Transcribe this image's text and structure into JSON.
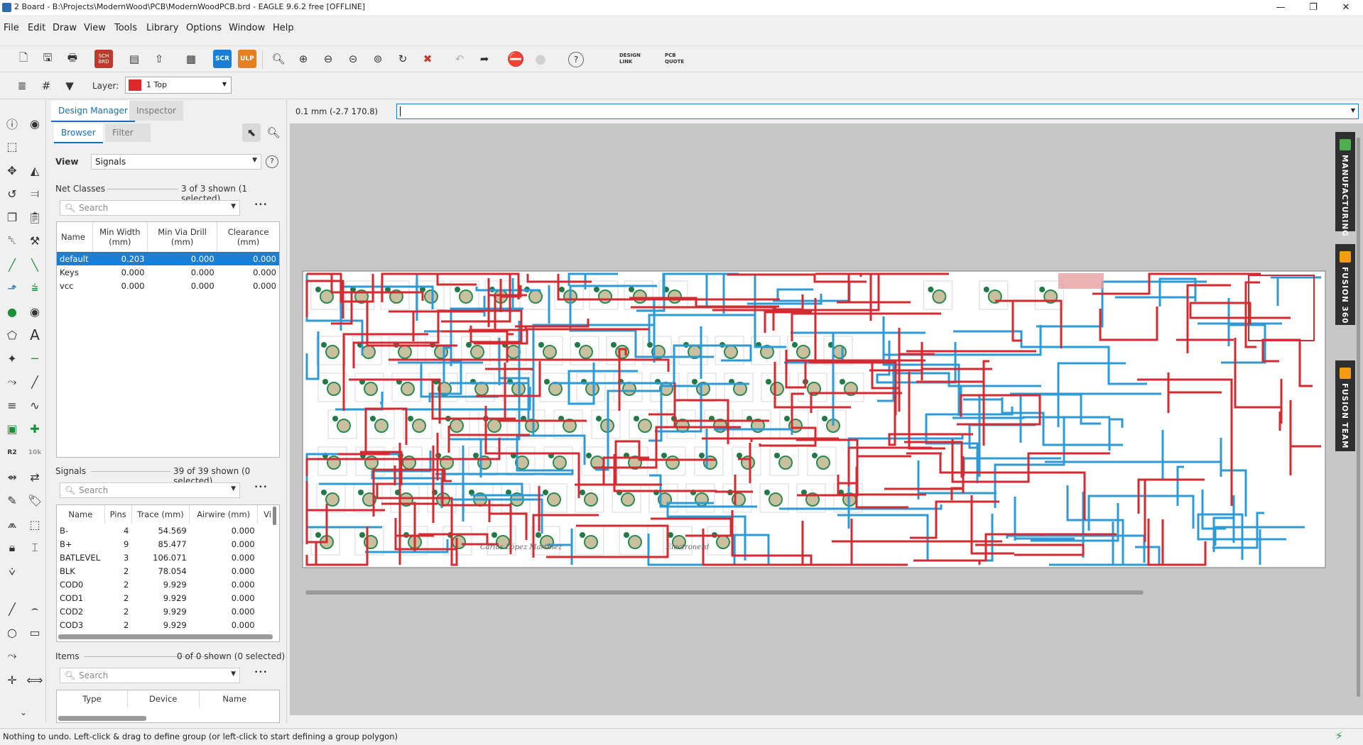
{
  "window": {
    "title": "2 Board - B:\\Projects\\ModernWood\\PCB\\ModernWoodPCB.brd - EAGLE 9.6.2 free [OFFLINE]",
    "min_glyph": "—",
    "max_glyph": "❐",
    "close_glyph": "✕"
  },
  "menu": [
    "File",
    "Edit",
    "Draw",
    "View",
    "Tools",
    "Library",
    "Options",
    "Window",
    "Help"
  ],
  "toolbar": {
    "sch_label": "SCH BRD",
    "scr_label": "SCR",
    "ulp_label": "ULP",
    "design_link_label": "DESIGN LINK",
    "pcb_quote_label": "PCB QUOTE",
    "help_glyph": "?"
  },
  "layerbar": {
    "layer_label": "Layer:",
    "layer_value": "1 Top",
    "layer_color": "#e0282a"
  },
  "panel": {
    "tabs": [
      "Design Manager",
      "Inspector"
    ],
    "subtabs": [
      "Browser",
      "Filter"
    ],
    "view_label": "View",
    "view_value": "Signals",
    "view_help": "?",
    "net_classes": {
      "label": "Net Classes",
      "count": "3 of 3 shown (1 selected)",
      "search_placeholder": "Search",
      "headers": [
        "Name",
        "Min Width\n(mm)",
        "Min Via Drill\n(mm)",
        "Clearance\n(mm)"
      ],
      "rows": [
        [
          "default",
          "0.203",
          "0.000",
          "0.000"
        ],
        [
          "Keys",
          "0.000",
          "0.000",
          "0.000"
        ],
        [
          "vcc",
          "0.000",
          "0.000",
          "0.000"
        ]
      ]
    },
    "signals": {
      "label": "Signals",
      "count": "39 of 39 shown (0 selected)",
      "search_placeholder": "Search",
      "headers": [
        "Name",
        "Pins",
        "Trace (mm)",
        "Airwire (mm)",
        "Vi"
      ],
      "rows": [
        [
          "B-",
          "4",
          "54.569",
          "0.000"
        ],
        [
          "B+",
          "9",
          "85.477",
          "0.000"
        ],
        [
          "BATLEVEL",
          "3",
          "106.071",
          "0.000"
        ],
        [
          "BLK",
          "2",
          "78.054",
          "0.000"
        ],
        [
          "COD0",
          "2",
          "9.929",
          "0.000"
        ],
        [
          "COD1",
          "2",
          "9.929",
          "0.000"
        ],
        [
          "COD2",
          "2",
          "9.929",
          "0.000"
        ],
        [
          "COD3",
          "2",
          "9.929",
          "0.000"
        ]
      ]
    },
    "items": {
      "label": "Items",
      "count": "0 of 0 shown (0 selected)",
      "search_placeholder": "Search",
      "headers": [
        "Type",
        "Device",
        "Name"
      ]
    },
    "more_glyph": "•••"
  },
  "canvas": {
    "coords": "0.1 mm (-2.7 170.8)",
    "pcb_label_1": "Carlos López Martínez",
    "pcb_label_2": "Electronerd"
  },
  "side_panels": [
    {
      "label": "MANUFACTURING",
      "color": "#4caf50"
    },
    {
      "label": "FUSION 360",
      "color": "#f39c12"
    },
    {
      "label": "FUSION TEAM",
      "color": "#f39c12"
    }
  ],
  "status": {
    "text": "Nothing to undo. Left-click & drag to define group (or left-click to start defining a group polygon)"
  }
}
